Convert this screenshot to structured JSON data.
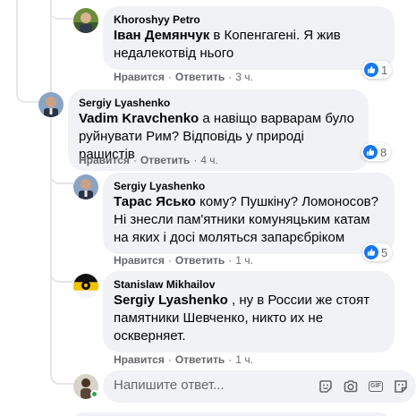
{
  "comments": [
    {
      "author": "Khoroshyy Petro",
      "mention": "Іван Демянчук",
      "text": " в Копенгагені. Я жив недалекотвід нього",
      "like": "Нравится",
      "reply": "Ответить",
      "time": "3 ч.",
      "reactions": "1"
    },
    {
      "author": "Sergiy Lyashenko",
      "mention": "Vadim Kravchenko",
      "text": " а навіщо варварам було руйнувати Рим? Відповідь у природі рашистів",
      "like": "Нравится",
      "reply": "Ответить",
      "time": "4 ч.",
      "reactions": "8"
    },
    {
      "author": "Sergiy Lyashenko",
      "mention": "Тарас Ясько",
      "text": " кому? Пушкіну? Ломоносов? Ні знесли пам'ятники комуняцьким катам на яких і досі моляться запарєбріком",
      "like": "Нравится",
      "reply": "Ответить",
      "time": "1 ч.",
      "reactions": "5"
    },
    {
      "author": "Stanislaw Mikhailov",
      "mention": "Sergiy Lyashenko",
      "text": " , ну в России же стоят памятники Шевченко, никто их не оскверняет.",
      "like": "Нравится",
      "reply": "Ответить",
      "time": "1 ч."
    }
  ],
  "reply_box": {
    "placeholder": "Напишите ответ..."
  },
  "icons": {
    "reaction": "like-icon",
    "tools": [
      "sticker-icon",
      "camera-icon",
      "gif-icon",
      "emoji-sticker-icon"
    ]
  },
  "colors": {
    "bubble": "#f0f2f5",
    "like_blue": "#1877f2",
    "meta_text": "#65676b",
    "online": "#31a24c"
  }
}
